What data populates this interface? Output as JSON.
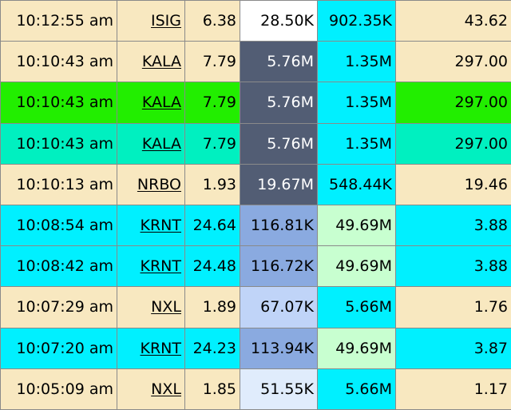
{
  "rows": [
    {
      "time": "10:12:55 am",
      "symbol": "ISIG",
      "price": "6.38",
      "volume": "28.50K",
      "float": "902.35K",
      "last": "43.62",
      "row_bg": "#f8e8c0",
      "vol_bg": "#ffffff",
      "vol_fg": "#000000",
      "float_bg": "#00f0ff",
      "last_bg": "#f8e8c0"
    },
    {
      "time": "10:10:43 am",
      "symbol": "KALA",
      "price": "7.79",
      "volume": "5.76M",
      "float": "1.35M",
      "last": "297.00",
      "row_bg": "#f8e8c0",
      "vol_bg": "#525d74",
      "vol_fg": "#ffffff",
      "float_bg": "#00f0ff",
      "last_bg": "#f8e8c0"
    },
    {
      "time": "10:10:43 am",
      "symbol": "KALA",
      "price": "7.79",
      "volume": "5.76M",
      "float": "1.35M",
      "last": "297.00",
      "row_bg": "#22ee00",
      "vol_bg": "#525d74",
      "vol_fg": "#ffffff",
      "float_bg": "#00f0ff",
      "last_bg": "#22ee00"
    },
    {
      "time": "10:10:43 am",
      "symbol": "KALA",
      "price": "7.79",
      "volume": "5.76M",
      "float": "1.35M",
      "last": "297.00",
      "row_bg": "#00f0c0",
      "vol_bg": "#525d74",
      "vol_fg": "#ffffff",
      "float_bg": "#00f0ff",
      "last_bg": "#00f0c0"
    },
    {
      "time": "10:10:13 am",
      "symbol": "NRBO",
      "price": "1.93",
      "volume": "19.67M",
      "float": "548.44K",
      "last": "19.46",
      "row_bg": "#f8e8c0",
      "vol_bg": "#525d74",
      "vol_fg": "#ffffff",
      "float_bg": "#00f0ff",
      "last_bg": "#f8e8c0"
    },
    {
      "time": "10:08:54 am",
      "symbol": "KRNT",
      "price": "24.64",
      "volume": "116.81K",
      "float": "49.69M",
      "last": "3.88",
      "row_bg": "#00f0ff",
      "vol_bg": "#8aaae0",
      "vol_fg": "#000000",
      "float_bg": "#c8ffd0",
      "last_bg": "#00f0ff"
    },
    {
      "time": "10:08:42 am",
      "symbol": "KRNT",
      "price": "24.48",
      "volume": "116.72K",
      "float": "49.69M",
      "last": "3.88",
      "row_bg": "#00f0ff",
      "vol_bg": "#8aaae0",
      "vol_fg": "#000000",
      "float_bg": "#c8ffd0",
      "last_bg": "#00f0ff"
    },
    {
      "time": "10:07:29 am",
      "symbol": "NXL",
      "price": "1.89",
      "volume": "67.07K",
      "float": "5.66M",
      "last": "1.76",
      "row_bg": "#f8e8c0",
      "vol_bg": "#c0d4f8",
      "vol_fg": "#000000",
      "float_bg": "#00f0ff",
      "last_bg": "#f8e8c0"
    },
    {
      "time": "10:07:20 am",
      "symbol": "KRNT",
      "price": "24.23",
      "volume": "113.94K",
      "float": "49.69M",
      "last": "3.87",
      "row_bg": "#00f0ff",
      "vol_bg": "#8aaae0",
      "vol_fg": "#000000",
      "float_bg": "#c8ffd0",
      "last_bg": "#00f0ff"
    },
    {
      "time": "10:05:09 am",
      "symbol": "NXL",
      "price": "1.85",
      "volume": "51.55K",
      "float": "5.66M",
      "last": "1.17",
      "row_bg": "#f8e8c0",
      "vol_bg": "#e0ecfc",
      "vol_fg": "#000000",
      "float_bg": "#00f0ff",
      "last_bg": "#f8e8c0"
    }
  ]
}
